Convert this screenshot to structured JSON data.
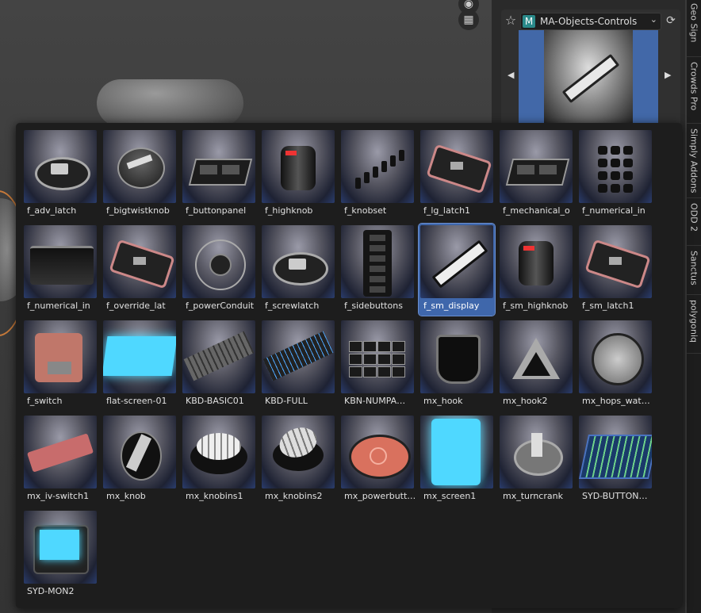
{
  "viewport": {
    "icons": [
      {
        "name": "camera-icon",
        "glyph": "📷"
      },
      {
        "name": "grid-icon",
        "glyph": "▦"
      }
    ]
  },
  "material_panel": {
    "badge": "M",
    "material_name": "MA-Objects-Controls",
    "star_icon": "star-icon",
    "refresh_icon": "refresh-icon"
  },
  "tabs": [
    "Geo Sign",
    "Crowds Pro",
    "Simply Addons",
    "ODD 2",
    "Sanctus",
    "polygoniq"
  ],
  "side_controls": {
    "percent_label": "%"
  },
  "asset_browser": {
    "selected_index": 13,
    "items": [
      {
        "label": "f_adv_latch",
        "style": "latch"
      },
      {
        "label": "f_bigtwistknob",
        "style": "knob"
      },
      {
        "label": "f_buttonpanel",
        "style": "panel"
      },
      {
        "label": "f_highknob",
        "style": "knob-dark"
      },
      {
        "label": "f_knobset",
        "style": "knobset"
      },
      {
        "label": "f_lg_latch1",
        "style": "latch-flat"
      },
      {
        "label": "f_mechanical_o",
        "style": "panel"
      },
      {
        "label": "f_numerical_in",
        "style": "keypad"
      },
      {
        "label": "f_numerical_in",
        "style": "box"
      },
      {
        "label": "f_override_lat",
        "style": "latch-flat"
      },
      {
        "label": "f_powerConduit",
        "style": "ring"
      },
      {
        "label": "f_screwlatch",
        "style": "latch"
      },
      {
        "label": "f_sidebuttons",
        "style": "sidebuttons"
      },
      {
        "label": "f_sm_display",
        "style": "display"
      },
      {
        "label": "f_sm_highknob",
        "style": "knob-dark"
      },
      {
        "label": "f_sm_latch1",
        "style": "latch-flat"
      },
      {
        "label": "f_switch",
        "style": "switch"
      },
      {
        "label": "flat-screen-01",
        "style": "screen-cyan"
      },
      {
        "label": "KBD-BASIC01",
        "style": "keyboard"
      },
      {
        "label": "KBD-FULL",
        "style": "keyboard-blue"
      },
      {
        "label": "KBN-NUMPA…",
        "style": "numpad"
      },
      {
        "label": "mx_hook",
        "style": "hook"
      },
      {
        "label": "mx_hook2",
        "style": "hook2"
      },
      {
        "label": "mx_hops_wat…",
        "style": "watch"
      },
      {
        "label": "mx_iv-switch1",
        "style": "iv-switch"
      },
      {
        "label": "mx_knob",
        "style": "knob-metal"
      },
      {
        "label": "mx_knobins1",
        "style": "knob-ins"
      },
      {
        "label": "mx_knobins2",
        "style": "knob-ins2"
      },
      {
        "label": "mx_powerbutt…",
        "style": "powerbutton"
      },
      {
        "label": "mx_screen1",
        "style": "screen-tall"
      },
      {
        "label": "mx_turncrank",
        "style": "crank"
      },
      {
        "label": "SYD-BUTTON…",
        "style": "syd-button"
      },
      {
        "label": "SYD-MON2",
        "style": "monitor"
      }
    ]
  },
  "colors": {
    "selection": "#3f67ab",
    "popup_bg": "#1d1d1d",
    "accent_cyan": "#4fd8ff"
  }
}
